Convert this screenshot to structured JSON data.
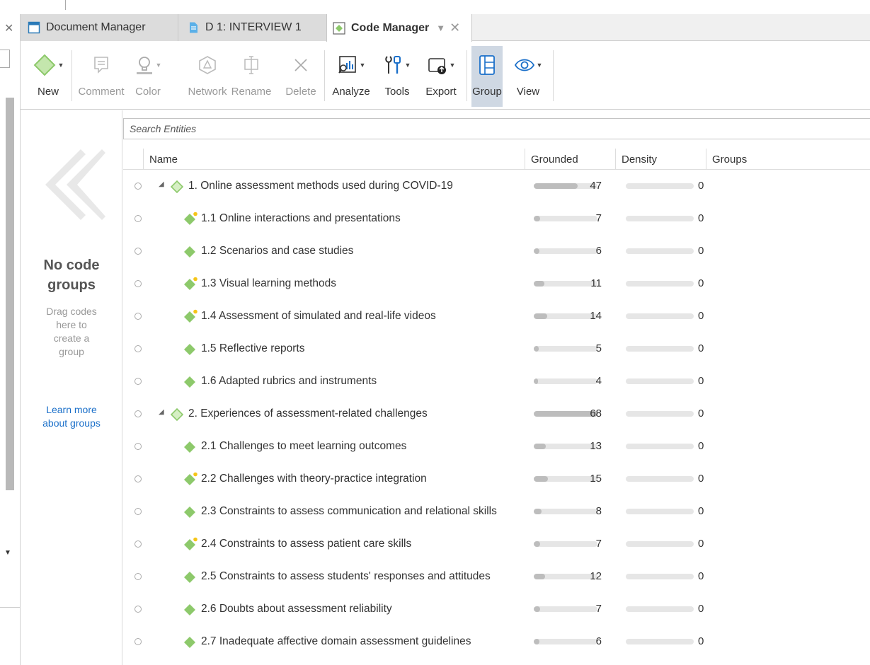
{
  "tabs": [
    {
      "label": "Document Manager"
    },
    {
      "label": "D 1: INTERVIEW 1"
    },
    {
      "label": "Code Manager",
      "active": true
    }
  ],
  "ribbon": {
    "new": "New",
    "comment": "Comment",
    "color": "Color",
    "network": "Network",
    "rename": "Rename",
    "delete": "Delete",
    "analyze": "Analyze",
    "tools": "Tools",
    "export": "Export",
    "group": "Group",
    "view": "View"
  },
  "groups_panel": {
    "title": "No code groups",
    "hint": "Drag codes here to create a group",
    "link": "Learn more about groups"
  },
  "search": {
    "placeholder": "Search Entities"
  },
  "columns": {
    "name": "Name",
    "grounded": "Grounded",
    "density": "Density",
    "groups": "Groups"
  },
  "colors": {
    "code_green": "#8dc96b",
    "memo_dot": "#f5c518",
    "link_blue": "#1a6fc9",
    "active_button": "#cfd8e3"
  },
  "rows": [
    {
      "name": "1. Online assessment methods used during COVID-19",
      "grounded": 47,
      "density": 0,
      "level": 0,
      "expanded": true,
      "has_comment": false
    },
    {
      "name": "1.1 Online interactions and presentations",
      "grounded": 7,
      "density": 0,
      "level": 1,
      "has_comment": true
    },
    {
      "name": "1.2 Scenarios and case studies",
      "grounded": 6,
      "density": 0,
      "level": 1,
      "has_comment": false
    },
    {
      "name": "1.3 Visual learning methods",
      "grounded": 11,
      "density": 0,
      "level": 1,
      "has_comment": true
    },
    {
      "name": "1.4 Assessment of simulated and real-life videos",
      "grounded": 14,
      "density": 0,
      "level": 1,
      "has_comment": true
    },
    {
      "name": "1.5 Reflective reports",
      "grounded": 5,
      "density": 0,
      "level": 1,
      "has_comment": false
    },
    {
      "name": "1.6 Adapted rubrics and instruments",
      "grounded": 4,
      "density": 0,
      "level": 1,
      "has_comment": false
    },
    {
      "name": "2. Experiences of assessment-related challenges",
      "grounded": 68,
      "density": 0,
      "level": 0,
      "expanded": true,
      "has_comment": false
    },
    {
      "name": "2.1 Challenges to meet learning outcomes",
      "grounded": 13,
      "density": 0,
      "level": 1,
      "has_comment": false
    },
    {
      "name": "2.2 Challenges with theory-practice integration",
      "grounded": 15,
      "density": 0,
      "level": 1,
      "has_comment": true
    },
    {
      "name": "2.3 Constraints to assess communication and relational skills",
      "grounded": 8,
      "density": 0,
      "level": 1,
      "has_comment": false
    },
    {
      "name": "2.4 Constraints to assess patient care skills",
      "grounded": 7,
      "density": 0,
      "level": 1,
      "has_comment": true
    },
    {
      "name": "2.5 Constraints to assess students' responses and attitudes",
      "grounded": 12,
      "density": 0,
      "level": 1,
      "has_comment": false
    },
    {
      "name": "2.6 Doubts about assessment reliability",
      "grounded": 7,
      "density": 0,
      "level": 1,
      "has_comment": false
    },
    {
      "name": "2.7 Inadequate affective domain assessment guidelines",
      "grounded": 6,
      "density": 0,
      "level": 1,
      "has_comment": false
    }
  ]
}
